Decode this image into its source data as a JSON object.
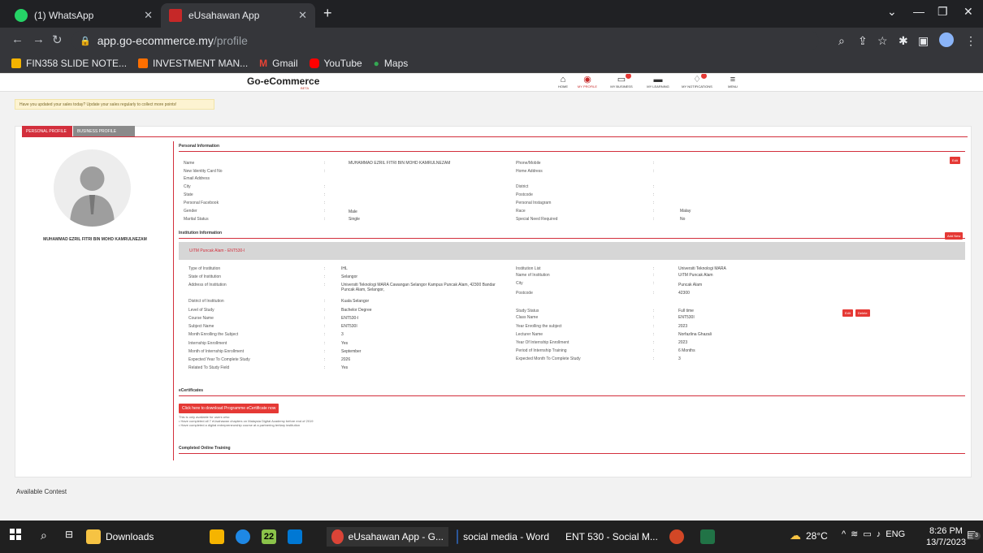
{
  "browser": {
    "tabs": [
      {
        "title": "(1) WhatsApp",
        "active": false
      },
      {
        "title": "eUsahawan App",
        "active": true
      }
    ],
    "url_host": "app.go-ecommerce.my",
    "url_path": "/profile",
    "bookmarks": [
      "FIN358 SLIDE NOTE...",
      "INVESTMENT MAN...",
      "Gmail",
      "YouTube",
      "Maps"
    ]
  },
  "site": {
    "logo": "Go-eCommerce",
    "logo_sub": "BETA",
    "nav": [
      {
        "label": "HOME",
        "icon": "home-icon"
      },
      {
        "label": "MY PROFILE",
        "icon": "profile-icon"
      },
      {
        "label": "MY BUSINESS",
        "icon": "business-chart-icon"
      },
      {
        "label": "MY LEARNING",
        "icon": "learning-icon"
      },
      {
        "label": "MY NOTIFICATIONS",
        "icon": "bell-icon"
      },
      {
        "label": "MENU",
        "icon": "menu-icon"
      }
    ],
    "notice": "Have you updated your sales today? Update your sales regularly to collect more points!"
  },
  "profile": {
    "tabs": [
      "PERSONAL PROFILE",
      "BUSINESS PROFILE"
    ],
    "display_name": "MUHAMMAD EZRIL FITRI BIN MOHD KAMRULNEZAM",
    "personal_title": "Personal Information",
    "edit_label": "Edit",
    "personal_left": [
      {
        "label": "Name",
        "value": "MUHAMMAD EZRIL FITRI BIN MOHD KAMRULNEZAM"
      },
      {
        "label": "New Identity Card No",
        "value": ""
      },
      {
        "label": "Email Address",
        "value": ""
      },
      {
        "label": "City",
        "value": ""
      },
      {
        "label": "State",
        "value": ""
      },
      {
        "label": "Personal Facebook",
        "value": ""
      },
      {
        "label": "Gender",
        "value": "Male"
      },
      {
        "label": "Marital Status",
        "value": "Single"
      }
    ],
    "personal_right": [
      {
        "label": "Phone/Mobile",
        "value": ""
      },
      {
        "label": "Home Address",
        "value": ""
      },
      {
        "label": "District",
        "value": ""
      },
      {
        "label": "Postcode",
        "value": ""
      },
      {
        "label": "Personal Instagram",
        "value": ""
      },
      {
        "label": "Race",
        "value": "Malay"
      },
      {
        "label": "Special Need Required",
        "value": "No"
      }
    ],
    "institution_title": "Institution Information",
    "add_new_label": "Add New",
    "institution_band": "UiTM Puncak Alam - ENT530-I",
    "delete_label": "Delete",
    "inst_left": [
      {
        "label": "Type of Institution",
        "value": "IHL"
      },
      {
        "label": "State of Institution",
        "value": "Selangor"
      },
      {
        "label": "Address of Institution",
        "value": "Universiti Teknologi MARA Cawangan Selangor Kampus Puncak Alam, 42300 Bandar Puncak Alam, Selangor,"
      },
      {
        "label": "District of Institution",
        "value": "Kuala Selangor"
      },
      {
        "label": "Level of Study",
        "value": "Bachelor Degree"
      },
      {
        "label": "Course Name",
        "value": "ENT530-I"
      },
      {
        "label": "Subject Name",
        "value": "ENT530I"
      },
      {
        "label": "Month Enrolling the Subject",
        "value": "3"
      },
      {
        "label": "Internship Enrollment",
        "value": "Yes"
      },
      {
        "label": "Month of Internship Enrollment",
        "value": "September"
      },
      {
        "label": "Expected Year To Complete Study",
        "value": "2026"
      },
      {
        "label": "Related To Study Field",
        "value": "Yes"
      }
    ],
    "inst_right": [
      {
        "label": "Institution List",
        "value": "Universiti Teknologi MARA"
      },
      {
        "label": "Name of Institution",
        "value": "UiTM Puncak Alam"
      },
      {
        "label": "City",
        "value": "Puncak Alam"
      },
      {
        "label": "Postcode",
        "value": "42300"
      },
      {
        "label": "Study Status",
        "value": "Full time"
      },
      {
        "label": "Class Name",
        "value": "ENT530I"
      },
      {
        "label": "Year Enrolling the subject",
        "value": "2023"
      },
      {
        "label": "Lecturer Name",
        "value": "Norfazlina Ghazali"
      },
      {
        "label": "Year Of Internship Enrollment",
        "value": "2023"
      },
      {
        "label": "Period of Internship Training",
        "value": "6 Months"
      },
      {
        "label": "Expected Month To Complete Study",
        "value": "3"
      }
    ],
    "ecert_title": "eCertificates",
    "ecert_button": "Click here to download Programme eCertificate now",
    "ecert_note": "This is only available for users who:",
    "ecert_bullets": [
      "Have completed all 7 eUsahawan chapters on Malaysia Digital Academy before end of 2019",
      "Have completed a digital entrepreneurship course at a partnering tertiary institution"
    ],
    "training_title": "Completed Online Training"
  },
  "footer_section": "Available Contest",
  "taskbar": {
    "apps": [
      "Downloads",
      "eUsahawan App - G...",
      "social media - Word",
      "ENT 530 - Social M..."
    ],
    "weather": "28°C",
    "lang": "ENG",
    "time": "8:26 PM",
    "date": "13/7/2023",
    "calendar_badge": "22",
    "notif_count": "3"
  }
}
